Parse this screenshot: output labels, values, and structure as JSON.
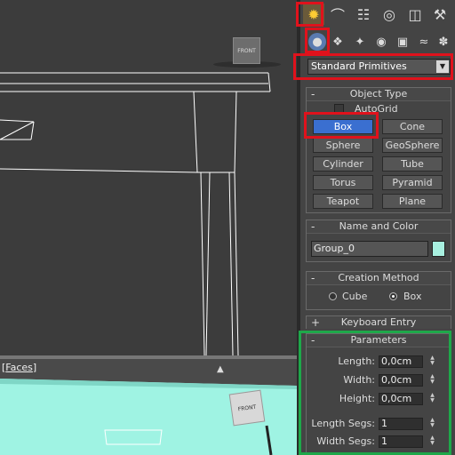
{
  "viewport_top": {
    "viewcube_label": "FRONT"
  },
  "viewport_bottom": {
    "label_left": "[",
    "label_faces": "Faces",
    "label_right": "]",
    "viewcube_label": "FRONT"
  },
  "command_panel": {
    "tabs": [
      "create-icon",
      "modify-icon",
      "hierarchy-icon",
      "motion-icon",
      "display-icon",
      "utilities-icon"
    ],
    "subtabs": [
      "geometry-icon",
      "shapes-icon",
      "lights-icon",
      "cameras-icon",
      "helpers-icon",
      "spacewarps-icon",
      "systems-icon"
    ],
    "category_dropdown": "Standard Primitives",
    "object_type": {
      "title": "Object Type",
      "autogrid_label": "AutoGrid",
      "buttons": [
        "Box",
        "Cone",
        "Sphere",
        "GeoSphere",
        "Cylinder",
        "Tube",
        "Torus",
        "Pyramid",
        "Teapot",
        "Plane"
      ]
    },
    "name_and_color": {
      "title": "Name and Color",
      "name_value": "Group_0",
      "color": "#a8f0e0"
    },
    "creation_method": {
      "title": "Creation Method",
      "option_cube": "Cube",
      "option_box": "Box"
    },
    "keyboard_entry": {
      "title": "Keyboard Entry",
      "sign": "+"
    },
    "parameters": {
      "title": "Parameters",
      "length_label": "Length:",
      "length_value": "0,0cm",
      "width_label": "Width:",
      "width_value": "0,0cm",
      "height_label": "Height:",
      "height_value": "0,0cm",
      "length_segs_label": "Length Segs:",
      "length_segs_value": "1",
      "width_segs_label": "Width Segs:",
      "width_segs_value": "1"
    },
    "signs": {
      "minus": "-"
    }
  },
  "colors": {
    "highlight_red": "#e0121c",
    "highlight_green": "#1ea84a",
    "active_button": "#3a6fd0"
  }
}
